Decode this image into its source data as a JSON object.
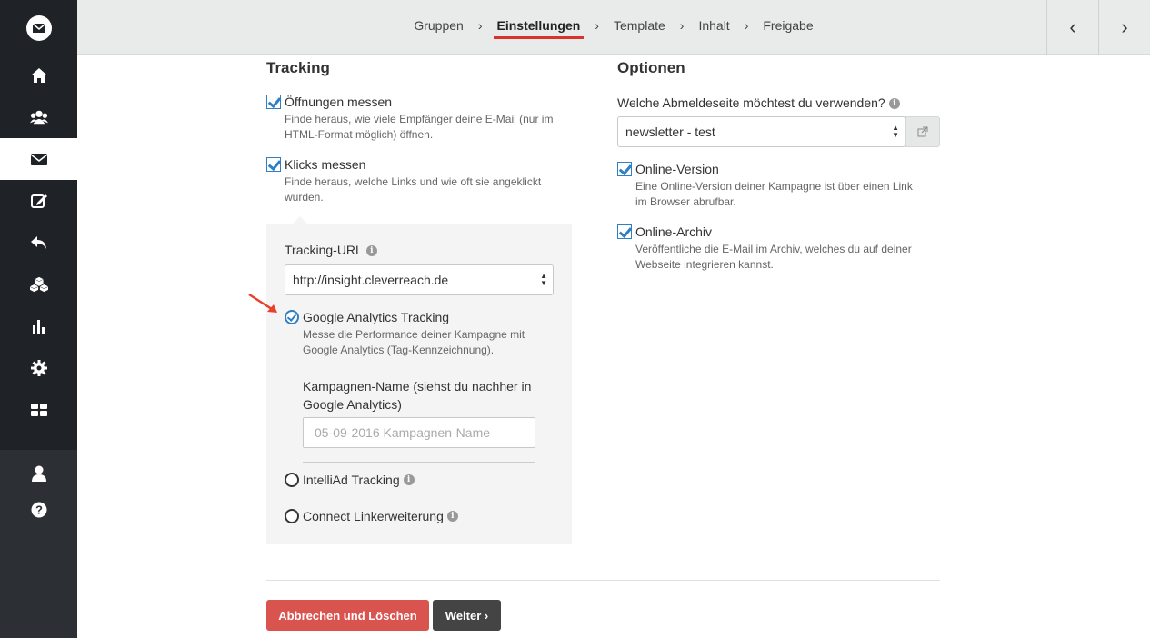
{
  "breadcrumbs": [
    "Gruppen",
    "Einstellungen",
    "Template",
    "Inhalt",
    "Freigabe"
  ],
  "breadcrumb_active_index": 1,
  "pager": {
    "prev": "‹",
    "next": "›"
  },
  "sidebar": {
    "icons": [
      "envelope-logo-icon",
      "home-icon",
      "users-icon",
      "envelope-icon",
      "edit-icon",
      "reply-icon",
      "cubes-icon",
      "bar-chart-icon",
      "gear-icon",
      "grid-icon",
      "user-icon",
      "help-icon"
    ],
    "active": "envelope-icon"
  },
  "tracking": {
    "title": "Tracking",
    "open_label": "Öffnungen messen",
    "open_desc_1": "Finde heraus, wie viele Empfänger deine E-Mail (nur im",
    "open_desc_2": "HTML-Format möglich) öffnen.",
    "open_checked": true,
    "click_label": "Klicks messen",
    "click_desc_1": "Finde heraus, welche Links und wie oft sie angeklickt",
    "click_desc_2": "wurden.",
    "click_checked": true,
    "url_label": "Tracking-URL",
    "url_value": "http://insight.cleverreach.de",
    "ga_label": "Google Analytics Tracking",
    "ga_desc_1": "Messe die Performance deiner Kampagne mit",
    "ga_desc_2": "Google Analytics (Tag-Kennzeichnung).",
    "campaign_label_1": "Kampagnen-Name (siehst du nachher in",
    "campaign_label_2": "Google Analytics)",
    "campaign_placeholder": "05-09-2016 Kampagnen-Name",
    "intelliad_label": "IntelliAd Tracking",
    "connect_label": "Connect Linkerweiterung"
  },
  "options": {
    "title": "Optionen",
    "unsub_label": "Welche Abmeldeseite möchtest du verwenden?",
    "unsub_value": "newsletter - test",
    "online_label": "Online-Version",
    "online_desc_1": "Eine Online-Version deiner Kampagne ist über einen Link",
    "online_desc_2": "im Browser abrufbar.",
    "archive_label": "Online-Archiv",
    "archive_desc_1": "Veröffentliche die E-Mail im Archiv, welches du auf deiner",
    "archive_desc_2": "Webseite integrieren kannst."
  },
  "buttons": {
    "cancel": "Abbrechen und Löschen",
    "next": "Weiter ›"
  },
  "colors": {
    "danger": "#d9534f",
    "dark": "#444444",
    "accent": "#2e7fc3",
    "sidebar": "#1f2226",
    "arrow": "#e8412c"
  }
}
